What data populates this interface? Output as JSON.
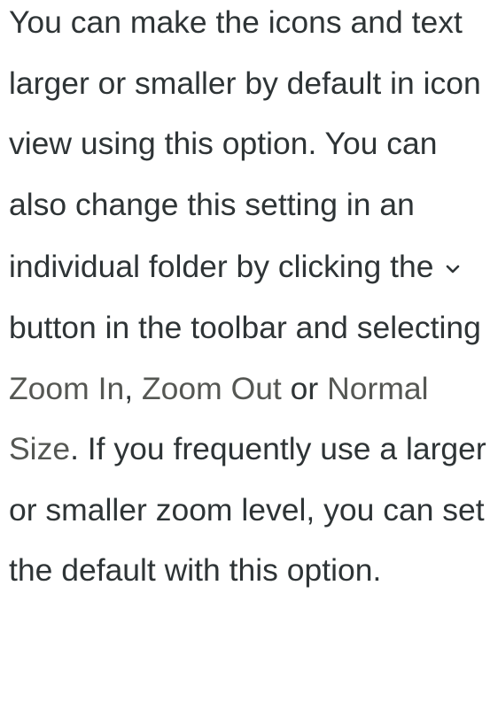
{
  "paragraph": {
    "text_1": "You can make the icons and text larger or smaller by default in icon view using this option. You can also change this setting in an individual folder by clicking the",
    "text_2": "button in the toolbar and selecting",
    "gui_zoom_in": "Zoom In",
    "sep_1": ",",
    "gui_zoom_out": "Zoom Out",
    "text_or": "or",
    "gui_normal_size": "Normal Size",
    "text_3": ". If you frequently use a larger or smaller zoom level, you can set the default with this option."
  },
  "icons": {
    "menu_button": "chevron-down-icon"
  },
  "colors": {
    "text": "#2e3436",
    "gui_label": "#555753"
  }
}
